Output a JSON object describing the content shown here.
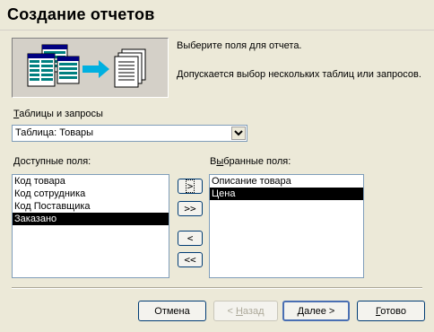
{
  "window": {
    "title": "Создание отчетов"
  },
  "intro": {
    "line1": "Выберите поля для отчета.",
    "line2": "Допускается выбор нескольких таблиц или запросов."
  },
  "source": {
    "label_mnemonic": "Т",
    "label_rest": "аблицы и запросы",
    "selected": "Таблица: Товары"
  },
  "available": {
    "label_mnemonic": "Д",
    "label_rest": "оступные поля:",
    "items": [
      "Код товара",
      "Код сотрудника",
      "Код Поставщика",
      "Заказано"
    ],
    "selected_index": 3
  },
  "selected_fields": {
    "label_pre": "В",
    "label_mnemonic": "ы",
    "label_rest": "бранные поля:",
    "items": [
      "Описание товара",
      "Цена"
    ],
    "selected_index": 1
  },
  "move_buttons": {
    "add_one": ">",
    "add_all": ">>",
    "remove_one": "<",
    "remove_all": "<<"
  },
  "footer": {
    "cancel": "Отмена",
    "back_pre": "< ",
    "back_mnemonic": "Н",
    "back_rest": "азад",
    "next_pre": "",
    "next_mnemonic": "Д",
    "next_rest": "алее >",
    "finish_mnemonic": "Г",
    "finish_rest": "отово"
  },
  "colors": {
    "selection": "#000000",
    "dialog_bg": "#ece9d8",
    "arrow": "#00b0e0"
  }
}
